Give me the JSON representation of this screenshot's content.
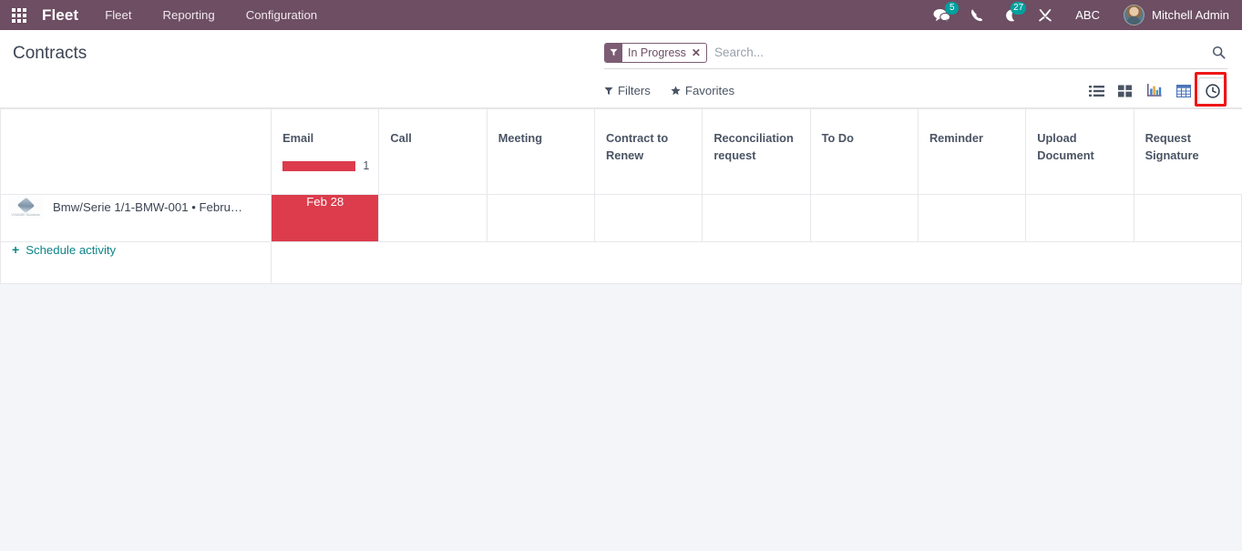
{
  "navbar": {
    "apps_icon": "apps-grid-icon",
    "brand": "Fleet",
    "menu": [
      {
        "label": "Fleet"
      },
      {
        "label": "Reporting"
      },
      {
        "label": "Configuration"
      }
    ],
    "right": {
      "messages_icon": "messages-icon",
      "messages_count": "5",
      "phone_icon": "phone-icon",
      "activities_icon": "activities-clock-icon",
      "activities_count": "27",
      "tools_icon": "tools-icon",
      "debug_label": "ABC",
      "avatar_icon": "user-avatar",
      "user_name": "Mitchell Admin"
    }
  },
  "control_panel": {
    "title": "Contracts",
    "search": {
      "facet": {
        "icon": "filter-funnel-icon",
        "label": "In Progress",
        "close_label": "✕"
      },
      "placeholder": "Search...",
      "value": "",
      "search_icon": "search-icon"
    },
    "filters_label": "Filters",
    "favorites_label": "Favorites",
    "filters_icon": "funnel-icon",
    "favorites_icon": "star-icon",
    "views": [
      {
        "name": "list",
        "icon": "list-view-icon",
        "active": false
      },
      {
        "name": "kanban",
        "icon": "kanban-view-icon",
        "active": false
      },
      {
        "name": "graph",
        "icon": "graph-view-icon",
        "active": false
      },
      {
        "name": "pivot",
        "icon": "pivot-view-icon",
        "active": false
      },
      {
        "name": "activity",
        "icon": "activity-clock-view-icon",
        "active": true
      }
    ],
    "highlight_color": "#ef1616"
  },
  "activity_table": {
    "record_column_header": "",
    "columns": [
      {
        "label": "Email",
        "progress_percent": 100,
        "count": "1"
      },
      {
        "label": "Call",
        "progress_percent": 0,
        "count": ""
      },
      {
        "label": "Meeting",
        "progress_percent": 0,
        "count": ""
      },
      {
        "label": "Contract to Renew",
        "progress_percent": 0,
        "count": ""
      },
      {
        "label": "Reconciliation request",
        "progress_percent": 0,
        "count": ""
      },
      {
        "label": "To Do",
        "progress_percent": 0,
        "count": ""
      },
      {
        "label": "Reminder",
        "progress_percent": 0,
        "count": ""
      },
      {
        "label": "Upload Document",
        "progress_percent": 0,
        "count": ""
      },
      {
        "label": "Request Signature",
        "progress_percent": 0,
        "count": ""
      }
    ],
    "rows": [
      {
        "thumb_icon": "company-logo-thumbnail",
        "name": "Bmw/Serie 1/1-BMW-001 • Febru…",
        "cells": [
          {
            "label": "Feb 28",
            "state": "overdue"
          },
          {
            "label": "",
            "state": ""
          },
          {
            "label": "",
            "state": ""
          },
          {
            "label": "",
            "state": ""
          },
          {
            "label": "",
            "state": ""
          },
          {
            "label": "",
            "state": ""
          },
          {
            "label": "",
            "state": ""
          },
          {
            "label": "",
            "state": ""
          },
          {
            "label": "",
            "state": ""
          }
        ]
      }
    ],
    "schedule_activity_label": "Schedule activity",
    "schedule_plus": "+",
    "overdue_color": "#dc3c4c"
  }
}
